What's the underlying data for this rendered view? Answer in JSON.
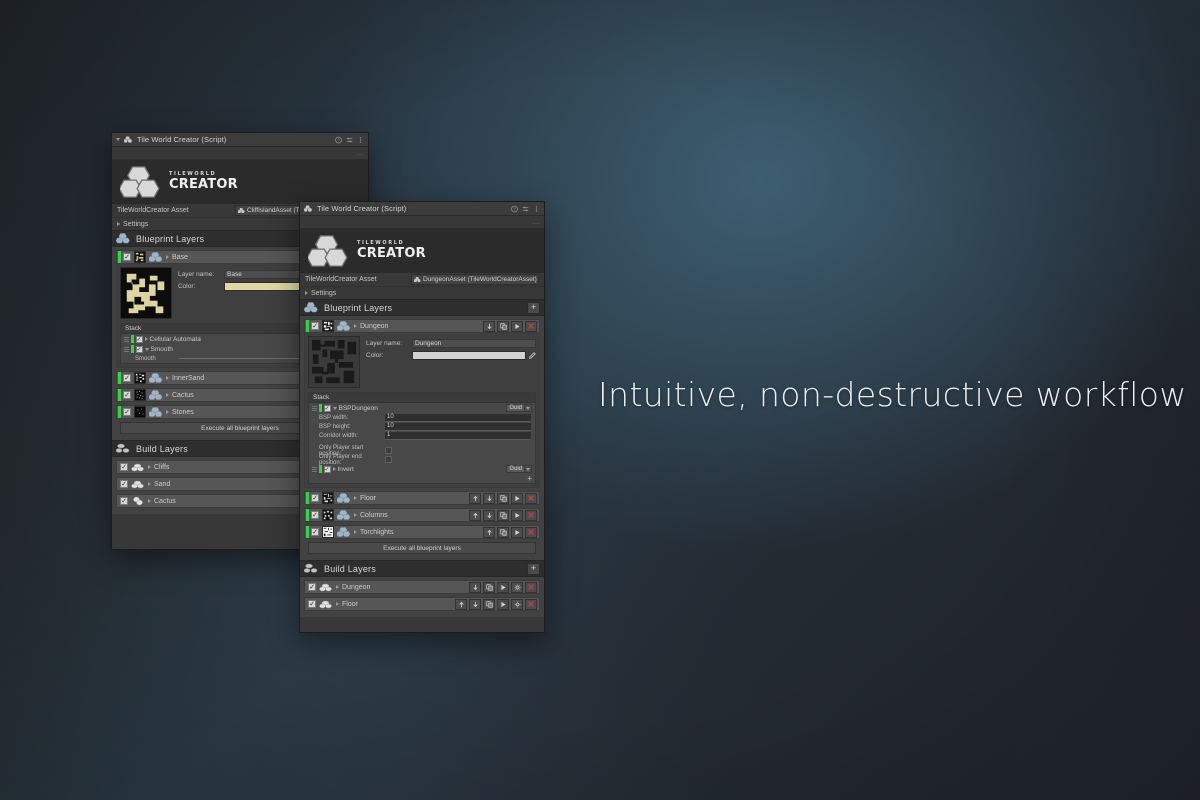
{
  "background": {
    "accent_teal": "#3a5366",
    "dark": "#212426"
  },
  "tagline": "Intuitive, non-destructive workflow",
  "panels": {
    "back": {
      "titlebar": {
        "title": "Tile World Creator (Script)",
        "icons": [
          "help-icon",
          "preset-icon",
          "menu-icon"
        ]
      },
      "logo": {
        "top": "TILEWORLD",
        "bottom": "CREATOR"
      },
      "asset": {
        "label": "TileWorldCreator Asset",
        "value": "CliffIslandAsset (TileW"
      },
      "settings_label": "Settings",
      "blueprint_section": {
        "title": "Blueprint Layers"
      },
      "blueprint_layers": [
        {
          "name": "Base",
          "expanded": true,
          "enabled": true
        },
        {
          "name": "InnerSand",
          "expanded": false,
          "enabled": true
        },
        {
          "name": "Cactus",
          "expanded": false,
          "enabled": true
        },
        {
          "name": "Stones",
          "expanded": false,
          "enabled": true
        }
      ],
      "expanded_layer": {
        "layer_name_label": "Layer name:",
        "layer_name_value": "Base",
        "color_label": "Color:",
        "color_value": "#ddd9a0",
        "stack_title": "Stack",
        "stack_items": [
          {
            "name": "Cellular Automata",
            "enabled": true
          },
          {
            "name": "Smooth",
            "enabled": true
          }
        ],
        "slider": {
          "label": "Smooth",
          "value": 82
        }
      },
      "execute_button": "Execute all blueprint layers",
      "build_section": {
        "title": "Build Layers"
      },
      "build_layers": [
        {
          "name": "Cliffs",
          "enabled": true
        },
        {
          "name": "Sand",
          "enabled": true
        },
        {
          "name": "Cactus",
          "enabled": true
        }
      ]
    },
    "front": {
      "titlebar": {
        "title": "Tile World Creator (Script)",
        "icons": [
          "help-icon",
          "preset-icon",
          "menu-icon"
        ]
      },
      "logo": {
        "top": "TILEWORLD",
        "bottom": "CREATOR"
      },
      "asset": {
        "label": "TileWorldCreator Asset",
        "value": "DungeonAsset (TileWorldCreatorAsset)"
      },
      "settings_label": "Settings",
      "blueprint_section": {
        "title": "Blueprint Layers",
        "add_label": "+"
      },
      "blueprint_layers": [
        {
          "name": "Dungeon",
          "expanded": true,
          "enabled": true
        },
        {
          "name": "Floor",
          "expanded": false,
          "enabled": true
        },
        {
          "name": "Columns",
          "expanded": false,
          "enabled": true
        },
        {
          "name": "Torchlights",
          "expanded": false,
          "enabled": true
        }
      ],
      "expanded_layer": {
        "layer_name_label": "Layer name:",
        "layer_name_value": "Dungeon",
        "color_label": "Color:",
        "color_value": "#d2d2d2",
        "stack_title": "Stack",
        "stack_items": [
          {
            "name": "BSPDungeon",
            "enabled": true,
            "guid_label": "Guid",
            "props": [
              {
                "label": "BSP width:",
                "value": "10",
                "type": "text"
              },
              {
                "label": "BSP height:",
                "value": "10",
                "type": "text"
              },
              {
                "label": "Corridor width:",
                "value": "1",
                "type": "text"
              },
              {
                "label": "Only Player start position:",
                "value": "",
                "type": "check"
              },
              {
                "label": "Only Player end position:",
                "value": "",
                "type": "check"
              }
            ]
          },
          {
            "name": "Invert",
            "enabled": true,
            "guid_label": "Guid",
            "props": []
          }
        ],
        "add_label": "+"
      },
      "execute_button": "Execute all blueprint layers",
      "build_section": {
        "title": "Build Layers",
        "add_label": "+"
      },
      "build_layers": [
        {
          "name": "Dungeon",
          "enabled": true
        },
        {
          "name": "Floor",
          "enabled": true
        }
      ]
    }
  }
}
